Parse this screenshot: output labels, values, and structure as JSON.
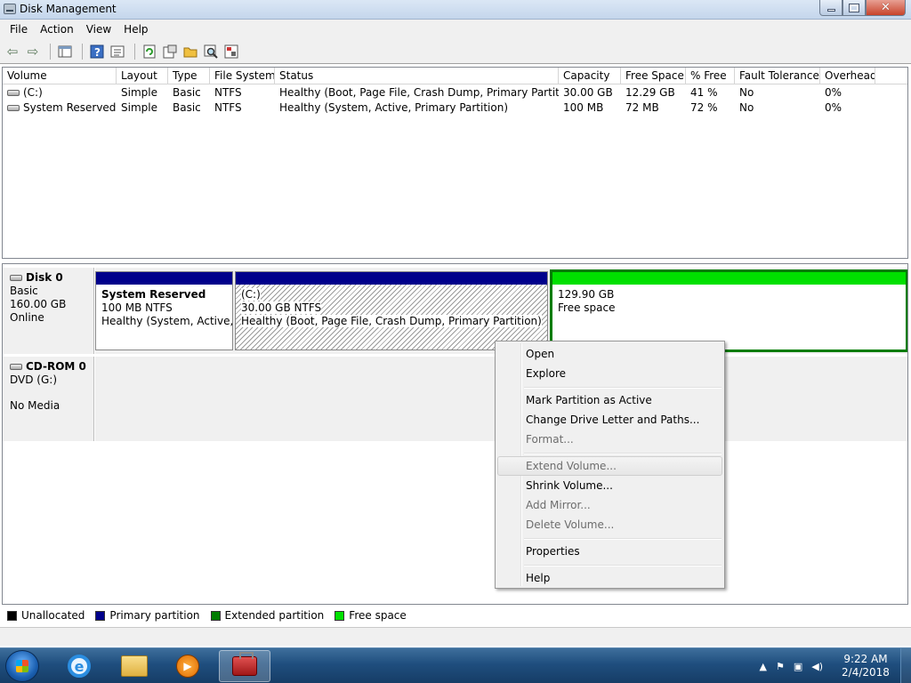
{
  "window": {
    "title": "Disk Management",
    "controls": {
      "minimize": "minimize",
      "maximize": "maximize",
      "close": "✕"
    }
  },
  "menubar": [
    "File",
    "Action",
    "View",
    "Help"
  ],
  "toolbar": [
    "back-arrow-icon",
    "forward-arrow-icon",
    "console-tree-icon",
    "help-icon",
    "properties-view-icon",
    "refresh-icon",
    "properties-icon",
    "open-icon",
    "search-icon",
    "settings-icon"
  ],
  "volume_list": {
    "columns": [
      "Volume",
      "Layout",
      "Type",
      "File System",
      "Status",
      "Capacity",
      "Free Space",
      "% Free",
      "Fault Tolerance",
      "Overhead"
    ],
    "rows": [
      [
        "(C:)",
        "Simple",
        "Basic",
        "NTFS",
        "Healthy (Boot, Page File, Crash Dump, Primary Partition)",
        "30.00 GB",
        "12.29 GB",
        "41 %",
        "No",
        "0%"
      ],
      [
        "System Reserved",
        "Simple",
        "Basic",
        "NTFS",
        "Healthy (System, Active, Primary Partition)",
        "100 MB",
        "72 MB",
        "72 %",
        "No",
        "0%"
      ]
    ]
  },
  "disks": [
    {
      "name": "Disk 0",
      "type": "Basic",
      "size": "160.00 GB",
      "status": "Online",
      "partitions": [
        {
          "title": "System Reserved",
          "line1": "100 MB NTFS",
          "line2": "Healthy (System, Active, Pr"
        },
        {
          "title": "(C:)",
          "line1": "30.00 GB NTFS",
          "line2": "Healthy (Boot, Page File, Crash Dump, Primary Partition)"
        },
        {
          "title": "",
          "line1": "129.90 GB",
          "line2": "Free space"
        }
      ]
    },
    {
      "name": "CD-ROM 0",
      "type": "DVD (G:)",
      "status": "No Media"
    }
  ],
  "context_menu": {
    "items": [
      {
        "label": "Open",
        "disabled": false
      },
      {
        "label": "Explore",
        "disabled": false
      },
      {
        "label": "Mark Partition as Active",
        "disabled": false
      },
      {
        "label": "Change Drive Letter and Paths...",
        "disabled": false
      },
      {
        "label": "Format...",
        "disabled": true
      },
      {
        "label": "Extend Volume...",
        "disabled": true,
        "highlighted": true
      },
      {
        "label": "Shrink Volume...",
        "disabled": false
      },
      {
        "label": "Add Mirror...",
        "disabled": true
      },
      {
        "label": "Delete Volume...",
        "disabled": true
      },
      {
        "label": "Properties",
        "disabled": false
      },
      {
        "label": "Help",
        "disabled": false
      }
    ]
  },
  "legend": [
    {
      "label": "Unallocated",
      "color": "#000000"
    },
    {
      "label": "Primary partition",
      "color": "#00008b"
    },
    {
      "label": "Extended partition",
      "color": "#007c00"
    },
    {
      "label": "Free space",
      "color": "#00e000"
    }
  ],
  "taskbar": {
    "apps": [
      "internet-explorer-icon",
      "windows-explorer-icon",
      "media-player-icon",
      "computer-management-icon"
    ],
    "tray": {
      "time": "9:22 AM",
      "date": "2/4/2018"
    }
  }
}
